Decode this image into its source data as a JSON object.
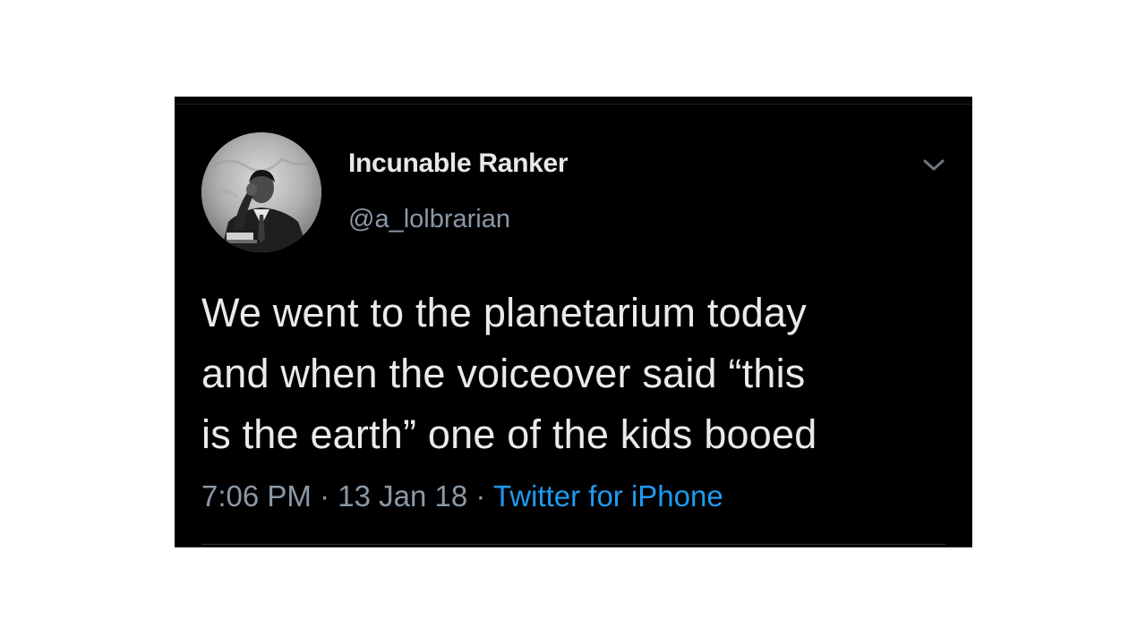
{
  "tweet": {
    "display_name": "Incunable Ranker",
    "handle": "@a_lolbrarian",
    "text": "We went to the planetarium today\nand when the voiceover said “this\nis the earth” one of the kids booed",
    "time": "7:06 PM",
    "separator": " · ",
    "date": "13 Jan 18",
    "source": "Twitter for iPhone",
    "avatar_icon": "profile-photo-avatar",
    "menu_icon": "chevron-down-icon"
  },
  "colors": {
    "background": "#000000",
    "name_text": "#e8e8e8",
    "secondary_text": "#8b98a5",
    "link": "#1d9bf0"
  }
}
